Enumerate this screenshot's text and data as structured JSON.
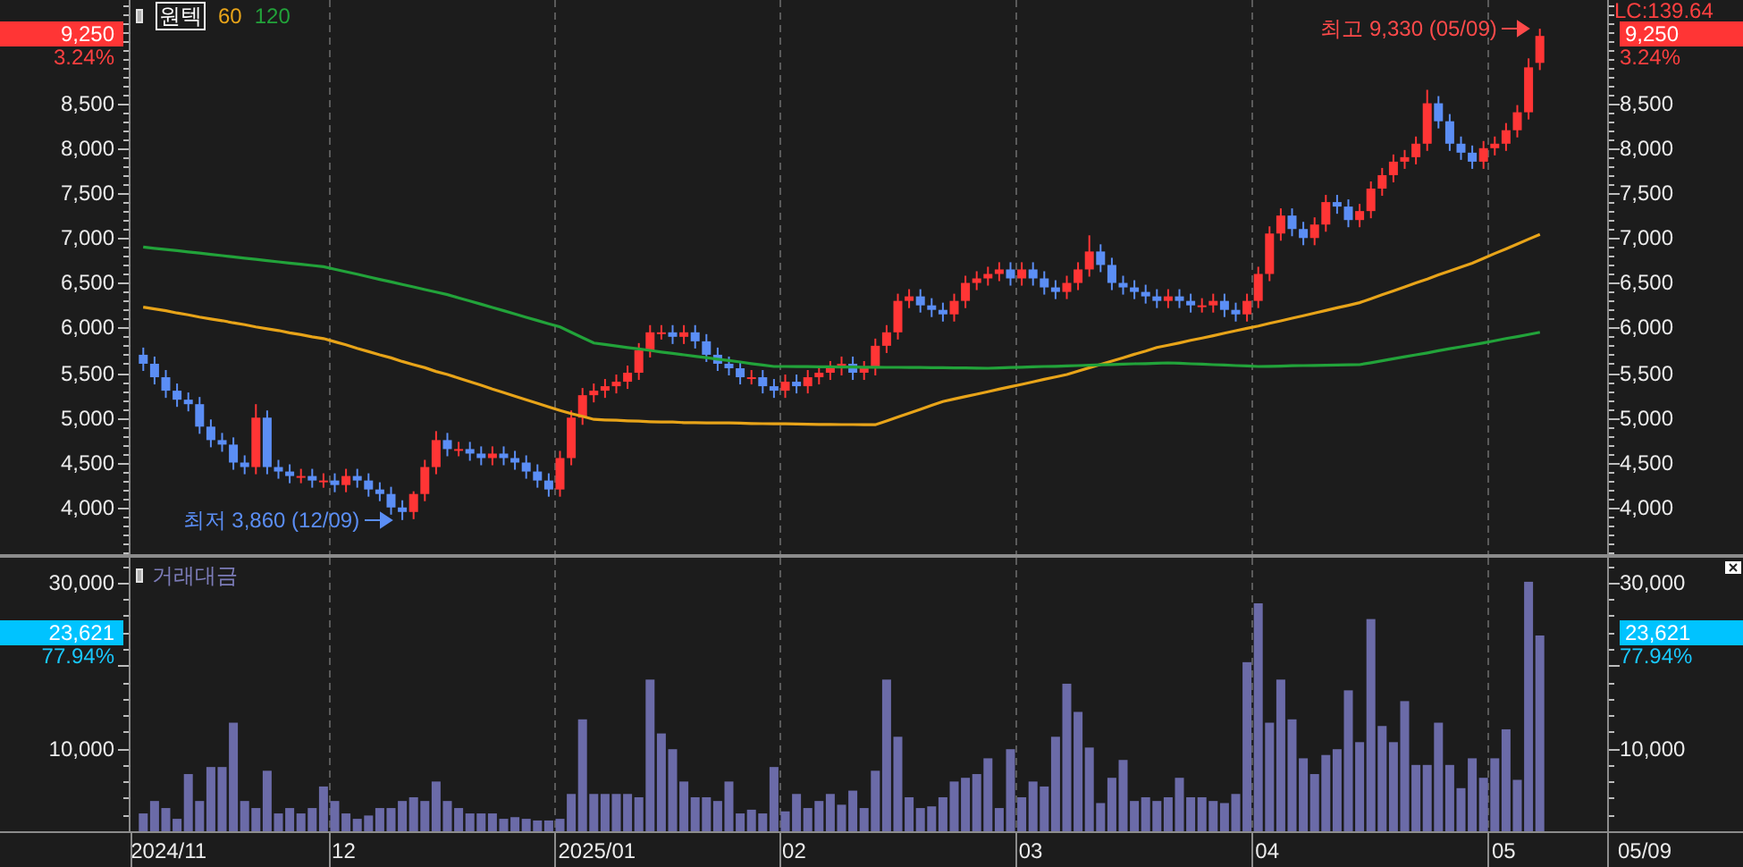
{
  "price_panel": {
    "left_tag": {
      "price": "9,250",
      "change": "3.24%"
    },
    "right_tag": {
      "lc": "LC:139.64",
      "price": "9,250",
      "change": "3.24%"
    },
    "right_axis": {
      "labels": [
        "8,500",
        "8,000",
        "7,500",
        "7,000",
        "6,500",
        "6,000",
        "5,500",
        "5,000",
        "4,500",
        "4,000"
      ]
    },
    "chart_data": {
      "type": "candlestick",
      "title": "원텍",
      "ylim": [
        3480,
        9650
      ],
      "yticks": [
        {
          "value": 4000,
          "label": "4,000"
        },
        {
          "value": 4500,
          "label": "4,500"
        },
        {
          "value": 5000,
          "label": "5,000"
        },
        {
          "value": 5500,
          "label": "5,500"
        },
        {
          "value": 6000,
          "label": "6,000"
        },
        {
          "value": 6500,
          "label": "6,500"
        },
        {
          "value": 7000,
          "label": "7,000"
        },
        {
          "value": 7500,
          "label": "7,500"
        },
        {
          "value": 8000,
          "label": "8,000"
        },
        {
          "value": 8500,
          "label": "8,500"
        }
      ],
      "categories": [
        null,
        null,
        null,
        null,
        null,
        null,
        null,
        null,
        null,
        null,
        null,
        null,
        null,
        null,
        null,
        null,
        null,
        null,
        null,
        null,
        null,
        null,
        null,
        null,
        null,
        null,
        null,
        null,
        null,
        null,
        null,
        null,
        null,
        null,
        null,
        null,
        null,
        null,
        null,
        null,
        null,
        null,
        null,
        null,
        null,
        null,
        null,
        null,
        null,
        null,
        null,
        null,
        null,
        null,
        null,
        null,
        null,
        null,
        null,
        null,
        null,
        null,
        null,
        null,
        null,
        null,
        null,
        null,
        null,
        null,
        null,
        null,
        null,
        null,
        null,
        null,
        null,
        null,
        null,
        null,
        null,
        null,
        null,
        null,
        null,
        null,
        null,
        null,
        null,
        null,
        null,
        null,
        null,
        null,
        null,
        null,
        null,
        null,
        null,
        null,
        null,
        null,
        null,
        null,
        null,
        null,
        null,
        null,
        null,
        null,
        null,
        null,
        null,
        null,
        null,
        null,
        null,
        null,
        null,
        null,
        null,
        null,
        null,
        null,
        null
      ],
      "ohlc": [
        [
          5700,
          5780,
          5520,
          5600
        ],
        [
          5600,
          5680,
          5370,
          5450
        ],
        [
          5450,
          5530,
          5220,
          5300
        ],
        [
          5300,
          5380,
          5120,
          5200
        ],
        [
          5200,
          5280,
          5070,
          5150
        ],
        [
          5150,
          5230,
          4820,
          4900
        ],
        [
          4900,
          4980,
          4670,
          4750
        ],
        [
          4750,
          4830,
          4620,
          4700
        ],
        [
          4700,
          4780,
          4420,
          4500
        ],
        [
          4500,
          4580,
          4370,
          4450
        ],
        [
          4450,
          5150,
          4370,
          5000
        ],
        [
          5000,
          5080,
          4370,
          4450
        ],
        [
          4450,
          4530,
          4320,
          4400
        ],
        [
          4400,
          4480,
          4270,
          4350
        ],
        [
          4350,
          4430,
          4270,
          4350
        ],
        [
          4350,
          4430,
          4220,
          4300
        ],
        [
          4300,
          4380,
          4220,
          4300
        ],
        [
          4300,
          4380,
          4170,
          4250
        ],
        [
          4250,
          4430,
          4170,
          4350
        ],
        [
          4350,
          4430,
          4220,
          4300
        ],
        [
          4300,
          4380,
          4120,
          4200
        ],
        [
          4200,
          4280,
          4070,
          4150
        ],
        [
          4150,
          4230,
          3920,
          4000
        ],
        [
          4000,
          4080,
          3860,
          3950
        ],
        [
          3950,
          4180,
          3870,
          4150
        ],
        [
          4150,
          4530,
          4070,
          4450
        ],
        [
          4450,
          4850,
          4370,
          4750
        ],
        [
          4750,
          4830,
          4570,
          4650
        ],
        [
          4650,
          4730,
          4570,
          4650
        ],
        [
          4650,
          4730,
          4520,
          4600
        ],
        [
          4600,
          4680,
          4470,
          4550
        ],
        [
          4550,
          4680,
          4470,
          4600
        ],
        [
          4600,
          4680,
          4470,
          4550
        ],
        [
          4550,
          4630,
          4420,
          4500
        ],
        [
          4500,
          4580,
          4320,
          4400
        ],
        [
          4400,
          4480,
          4220,
          4300
        ],
        [
          4300,
          4380,
          4120,
          4200
        ],
        [
          4200,
          4630,
          4120,
          4550
        ],
        [
          4550,
          5080,
          4470,
          5000
        ],
        [
          5000,
          5330,
          4920,
          5250
        ],
        [
          5250,
          5380,
          5170,
          5300
        ],
        [
          5300,
          5430,
          5220,
          5350
        ],
        [
          5350,
          5480,
          5270,
          5400
        ],
        [
          5400,
          5580,
          5320,
          5500
        ],
        [
          5500,
          5830,
          5420,
          5750
        ],
        [
          5750,
          6030,
          5670,
          5950
        ],
        [
          5950,
          6030,
          5870,
          5950
        ],
        [
          5950,
          6030,
          5820,
          5900
        ],
        [
          5900,
          6030,
          5820,
          5950
        ],
        [
          5950,
          6030,
          5770,
          5850
        ],
        [
          5850,
          5930,
          5620,
          5700
        ],
        [
          5700,
          5780,
          5520,
          5600
        ],
        [
          5600,
          5680,
          5470,
          5550
        ],
        [
          5550,
          5630,
          5370,
          5450
        ],
        [
          5450,
          5530,
          5370,
          5450
        ],
        [
          5450,
          5530,
          5270,
          5350
        ],
        [
          5350,
          5430,
          5220,
          5300
        ],
        [
          5300,
          5480,
          5220,
          5400
        ],
        [
          5400,
          5480,
          5270,
          5350
        ],
        [
          5350,
          5530,
          5270,
          5450
        ],
        [
          5450,
          5580,
          5370,
          5500
        ],
        [
          5500,
          5630,
          5420,
          5550
        ],
        [
          5550,
          5680,
          5470,
          5600
        ],
        [
          5600,
          5680,
          5420,
          5500
        ],
        [
          5500,
          5630,
          5420,
          5550
        ],
        [
          5550,
          5880,
          5470,
          5800
        ],
        [
          5800,
          6030,
          5720,
          5950
        ],
        [
          5950,
          6380,
          5870,
          6300
        ],
        [
          6300,
          6430,
          6220,
          6350
        ],
        [
          6350,
          6430,
          6170,
          6250
        ],
        [
          6250,
          6330,
          6120,
          6200
        ],
        [
          6200,
          6280,
          6070,
          6150
        ],
        [
          6150,
          6380,
          6070,
          6300
        ],
        [
          6300,
          6580,
          6220,
          6500
        ],
        [
          6500,
          6630,
          6420,
          6550
        ],
        [
          6550,
          6680,
          6470,
          6600
        ],
        [
          6600,
          6730,
          6520,
          6650
        ],
        [
          6650,
          6730,
          6470,
          6550
        ],
        [
          6550,
          6730,
          6470,
          6650
        ],
        [
          6650,
          6730,
          6470,
          6550
        ],
        [
          6550,
          6630,
          6370,
          6450
        ],
        [
          6450,
          6530,
          6320,
          6400
        ],
        [
          6400,
          6580,
          6320,
          6500
        ],
        [
          6500,
          6730,
          6420,
          6650
        ],
        [
          6650,
          7030,
          6570,
          6850
        ],
        [
          6850,
          6930,
          6620,
          6700
        ],
        [
          6700,
          6780,
          6420,
          6500
        ],
        [
          6500,
          6580,
          6370,
          6450
        ],
        [
          6450,
          6530,
          6320,
          6400
        ],
        [
          6400,
          6480,
          6270,
          6350
        ],
        [
          6350,
          6430,
          6220,
          6300
        ],
        [
          6300,
          6430,
          6220,
          6350
        ],
        [
          6350,
          6430,
          6220,
          6300
        ],
        [
          6300,
          6380,
          6170,
          6250
        ],
        [
          6250,
          6330,
          6170,
          6250
        ],
        [
          6250,
          6380,
          6170,
          6300
        ],
        [
          6300,
          6380,
          6120,
          6200
        ],
        [
          6200,
          6280,
          6070,
          6150
        ],
        [
          6150,
          6380,
          6070,
          6300
        ],
        [
          6300,
          6680,
          6220,
          6600
        ],
        [
          6600,
          7130,
          6520,
          7050
        ],
        [
          7050,
          7330,
          6970,
          7250
        ],
        [
          7250,
          7330,
          7020,
          7100
        ],
        [
          7100,
          7180,
          6920,
          7000
        ],
        [
          7000,
          7230,
          6920,
          7150
        ],
        [
          7150,
          7480,
          7070,
          7400
        ],
        [
          7400,
          7480,
          7270,
          7350
        ],
        [
          7350,
          7430,
          7120,
          7200
        ],
        [
          7200,
          7380,
          7120,
          7300
        ],
        [
          7300,
          7630,
          7220,
          7550
        ],
        [
          7550,
          7780,
          7470,
          7700
        ],
        [
          7700,
          7930,
          7620,
          7850
        ],
        [
          7850,
          7980,
          7770,
          7900
        ],
        [
          7900,
          8130,
          7820,
          8050
        ],
        [
          8050,
          8650,
          7970,
          8500
        ],
        [
          8500,
          8580,
          8220,
          8300
        ],
        [
          8300,
          8380,
          7970,
          8050
        ],
        [
          8050,
          8130,
          7870,
          7950
        ],
        [
          7950,
          8030,
          7770,
          7850
        ],
        [
          7850,
          8080,
          7770,
          8000
        ],
        [
          8000,
          8130,
          7920,
          8050
        ],
        [
          8050,
          8280,
          7970,
          8200
        ],
        [
          8200,
          8480,
          8120,
          8400
        ],
        [
          8400,
          9000,
          8320,
          8900
        ],
        [
          8950,
          9330,
          8870,
          9250
        ]
      ],
      "series": [
        {
          "name": "60",
          "type": "line",
          "color": "#e8a419",
          "values": [
            6230,
            6210,
            6190,
            6165,
            6145,
            6120,
            6100,
            6080,
            6055,
            6035,
            6010,
            5990,
            5970,
            5945,
            5925,
            5900,
            5880,
            5845,
            5810,
            5770,
            5735,
            5700,
            5665,
            5625,
            5590,
            5555,
            5515,
            5480,
            5440,
            5400,
            5360,
            5320,
            5280,
            5240,
            5200,
            5160,
            5120,
            5080,
            5045,
            5015,
            4980,
            4975,
            4970,
            4965,
            4960,
            4955,
            4950,
            4950,
            4945,
            4945,
            4940,
            4940,
            4940,
            4938,
            4935,
            4933,
            4930,
            4930,
            4928,
            4926,
            4925,
            4924,
            4923,
            4922,
            4921,
            4920,
            4963,
            5006,
            5050,
            5093,
            5136,
            5180,
            5207,
            5235,
            5262,
            5290,
            5317,
            5344,
            5371,
            5398,
            5426,
            5453,
            5480,
            5518,
            5555,
            5592,
            5630,
            5668,
            5705,
            5742,
            5780,
            5807,
            5833,
            5860,
            5887,
            5913,
            5940,
            5967,
            5993,
            6020,
            6049,
            6078,
            6107,
            6136,
            6164,
            6193,
            6222,
            6251,
            6280,
            6324,
            6368,
            6412,
            6456,
            6500,
            6544,
            6588,
            6632,
            6676,
            6720,
            6773,
            6827,
            6880,
            6933,
            6987,
            7040
          ]
        },
        {
          "name": "120",
          "type": "line",
          "color": "#22a33a",
          "values": [
            6900,
            6886,
            6872,
            6859,
            6845,
            6831,
            6818,
            6804,
            6790,
            6776,
            6762,
            6749,
            6735,
            6721,
            6708,
            6694,
            6680,
            6652,
            6624,
            6596,
            6567,
            6539,
            6511,
            6483,
            6455,
            6426,
            6398,
            6370,
            6334,
            6298,
            6262,
            6226,
            6190,
            6154,
            6118,
            6082,
            6046,
            6010,
            5950,
            5890,
            5830,
            5814,
            5797,
            5781,
            5765,
            5749,
            5732,
            5716,
            5700,
            5684,
            5667,
            5651,
            5635,
            5619,
            5602,
            5586,
            5570,
            5569,
            5568,
            5567,
            5566,
            5565,
            5564,
            5563,
            5562,
            5561,
            5560,
            5559,
            5558,
            5557,
            5556,
            5555,
            5554,
            5553,
            5552,
            5550,
            5554,
            5558,
            5561,
            5565,
            5569,
            5572,
            5576,
            5580,
            5584,
            5588,
            5591,
            5595,
            5599,
            5602,
            5606,
            5610,
            5605,
            5600,
            5595,
            5590,
            5585,
            5580,
            5575,
            5570,
            5572,
            5574,
            5577,
            5579,
            5581,
            5583,
            5586,
            5588,
            5590,
            5612,
            5634,
            5656,
            5678,
            5700,
            5722,
            5744,
            5766,
            5788,
            5810,
            5833,
            5857,
            5880,
            5903,
            5927,
            5950
          ]
        }
      ],
      "annotations": [
        {
          "text": "최고 9,330 (05/09)"
        },
        {
          "text": "최저 3,860 (12/09)"
        }
      ]
    }
  },
  "volume_panel": {
    "left_tag": {
      "value": "23,621",
      "ratio": "77.94%"
    },
    "right_tag": {
      "value": "23,621",
      "ratio": "77.94%"
    },
    "right_axis": {
      "labels": [
        "30,000",
        "10,000"
      ]
    },
    "chart_data": {
      "type": "bar",
      "ylim": [
        0,
        33000
      ],
      "yticks": [
        {
          "value": 10000,
          "label": "10,000"
        },
        {
          "value": 30000,
          "label": "30,000"
        }
      ],
      "categories": [
        null,
        null,
        null,
        "2024/11",
        null,
        null,
        null,
        null,
        null,
        null,
        null,
        null,
        null,
        null,
        null,
        null,
        null,
        null,
        "12",
        null,
        null,
        null,
        null,
        null,
        null,
        null,
        null,
        null,
        null,
        null,
        null,
        null,
        null,
        null,
        null,
        null,
        null,
        null,
        null,
        null,
        null,
        "2025/01",
        null,
        null,
        null,
        null,
        null,
        null,
        null,
        null,
        null,
        null,
        null,
        null,
        null,
        null,
        null,
        null,
        "02",
        null,
        null,
        null,
        null,
        null,
        null,
        null,
        null,
        null,
        null,
        null,
        null,
        null,
        null,
        null,
        null,
        null,
        null,
        null,
        null,
        "03",
        null,
        null,
        null,
        null,
        null,
        null,
        null,
        null,
        null,
        null,
        null,
        null,
        null,
        null,
        null,
        null,
        null,
        null,
        null,
        null,
        "04",
        null,
        null,
        null,
        null,
        null,
        null,
        null,
        null,
        null,
        null,
        null,
        null,
        null,
        null,
        null,
        null,
        null,
        null,
        null,
        null,
        "05",
        null,
        null,
        null
      ],
      "series": [
        {
          "name": "거래대금",
          "color": "#6b6ba8",
          "values": [
            2150,
            3650,
            2800,
            1500,
            6900,
            3650,
            7750,
            7750,
            13100,
            3650,
            2800,
            7300,
            2150,
            2800,
            2150,
            2800,
            5400,
            3650,
            2150,
            1500,
            1900,
            2800,
            2800,
            3650,
            4100,
            3650,
            6000,
            3650,
            2800,
            2150,
            2150,
            2150,
            1500,
            1700,
            1500,
            1300,
            1300,
            1500,
            4500,
            13500,
            4500,
            4500,
            4500,
            4500,
            4100,
            18300,
            11800,
            9900,
            6000,
            4100,
            4100,
            3650,
            6000,
            2150,
            2600,
            2150,
            7750,
            2400,
            4500,
            2800,
            3650,
            4500,
            3200,
            4900,
            2800,
            7300,
            18300,
            11400,
            4100,
            2800,
            3000,
            4100,
            6000,
            6450,
            6900,
            8800,
            2800,
            9900,
            4100,
            6000,
            5400,
            11400,
            17800,
            14400,
            10100,
            3400,
            6450,
            8600,
            3650,
            4100,
            3650,
            4100,
            6450,
            4100,
            4100,
            3650,
            3400,
            4500,
            20400,
            27500,
            13100,
            18300,
            13500,
            8800,
            6900,
            9200,
            9900,
            17000,
            10750,
            25600,
            12700,
            10750,
            15700,
            8000,
            8000,
            13100,
            8000,
            5200,
            8800,
            6450,
            8800,
            12300,
            6200,
            30100,
            23621
          ]
        }
      ]
    }
  },
  "date_axis": {
    "last_date": "05/09"
  }
}
